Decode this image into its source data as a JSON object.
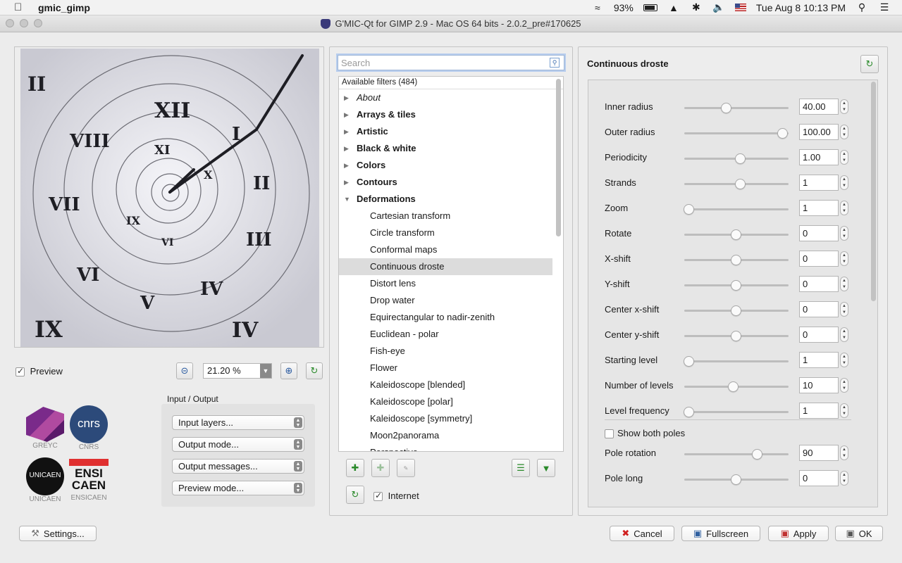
{
  "menubar": {
    "app_name": "gmic_gimp",
    "battery": "93%",
    "datetime": "Tue Aug 8  10:13 PM"
  },
  "window": {
    "title": "G'MIC-Qt for GIMP 2.9 - Mac OS 64 bits - 2.0.2_pre#170625"
  },
  "preview": {
    "checkbox_label": "Preview",
    "checked": true,
    "zoom": "21.20 %"
  },
  "logos": {
    "greyc": "GREYC",
    "cnrs": "CNRS",
    "unicaen": "UNICAEN",
    "ensicaen": "ENSICAEN",
    "cnrs_mark": "cnrs",
    "unicaen_mark": "UNICAEN",
    "ensicaen_mark": "ENSI CAEN"
  },
  "io": {
    "title": "Input / Output",
    "input_layers": "Input layers...",
    "output_mode": "Output mode...",
    "output_messages": "Output messages...",
    "preview_mode": "Preview mode..."
  },
  "settings_label": "Settings...",
  "search": {
    "placeholder": "Search"
  },
  "filters": {
    "header": "Available filters (484)",
    "categories": [
      {
        "label": "About",
        "italic": true
      },
      {
        "label": "Arrays & tiles"
      },
      {
        "label": "Artistic"
      },
      {
        "label": "Black & white"
      },
      {
        "label": "Colors"
      },
      {
        "label": "Contours"
      },
      {
        "label": "Deformations",
        "expanded": true
      }
    ],
    "items": [
      "Cartesian transform",
      "Circle transform",
      "Conformal maps",
      "Continuous droste",
      "Distort lens",
      "Drop water",
      "Equirectangular to nadir-zenith",
      "Euclidean - polar",
      "Fish-eye",
      "Flower",
      "Kaleidoscope [blended]",
      "Kaleidoscope [polar]",
      "Kaleidoscope [symmetry]",
      "Moon2panorama",
      "Perspective"
    ],
    "selected": "Continuous droste",
    "internet_label": "Internet",
    "internet_checked": true
  },
  "params": {
    "title": "Continuous droste",
    "rows": [
      {
        "label": "Inner radius",
        "value": "40.00",
        "level": 0.4
      },
      {
        "label": "Outer radius",
        "value": "100.00",
        "level": 1.0
      },
      {
        "label": "Periodicity",
        "value": "1.00",
        "level": 0.55
      },
      {
        "label": "Strands",
        "value": "1",
        "level": 0.55
      },
      {
        "label": "Zoom",
        "value": "1",
        "level": 0.0
      },
      {
        "label": "Rotate",
        "value": "0",
        "level": 0.5
      },
      {
        "label": "X-shift",
        "value": "0",
        "level": 0.5
      },
      {
        "label": "Y-shift",
        "value": "0",
        "level": 0.5
      },
      {
        "label": "Center x-shift",
        "value": "0",
        "level": 0.5
      },
      {
        "label": "Center y-shift",
        "value": "0",
        "level": 0.5
      },
      {
        "label": "Starting level",
        "value": "1",
        "level": 0.0
      },
      {
        "label": "Number of levels",
        "value": "10",
        "level": 0.47
      },
      {
        "label": "Level frequency",
        "value": "1",
        "level": 0.0
      }
    ],
    "show_both_poles": "Show both poles",
    "show_both_poles_checked": false,
    "rows2": [
      {
        "label": "Pole rotation",
        "value": "90",
        "level": 0.73
      },
      {
        "label": "Pole long",
        "value": "0",
        "level": 0.5
      }
    ]
  },
  "buttons": {
    "cancel": "Cancel",
    "fullscreen": "Fullscreen",
    "apply": "Apply",
    "ok": "OK"
  }
}
